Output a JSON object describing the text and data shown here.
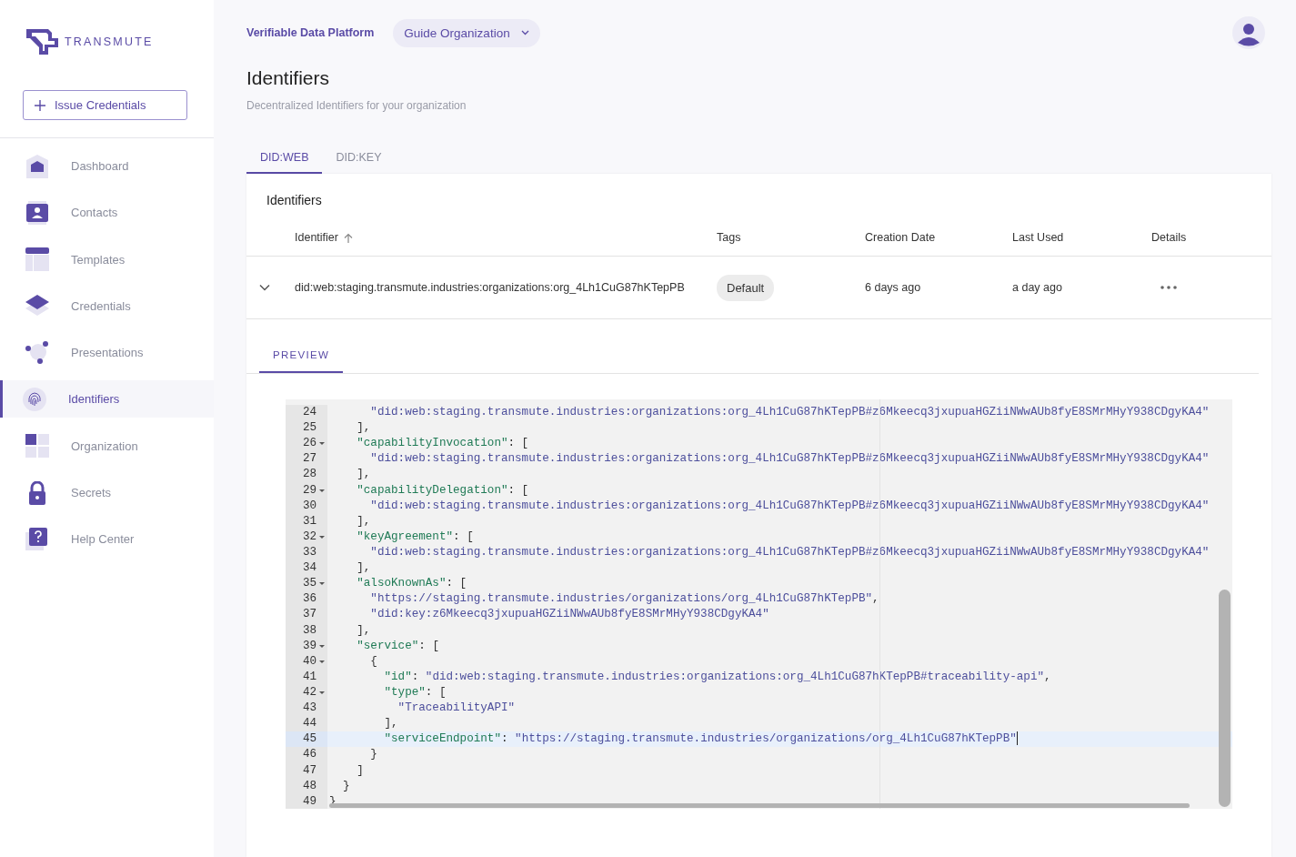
{
  "brand": {
    "name": "TRANSMUTE"
  },
  "sidebar": {
    "action_button": {
      "label": "Issue Credentials"
    },
    "items": [
      {
        "label": "Dashboard",
        "selected": false
      },
      {
        "label": "Contacts",
        "selected": false
      },
      {
        "label": "Templates",
        "selected": false
      },
      {
        "label": "Credentials",
        "selected": false
      },
      {
        "label": "Presentations",
        "selected": false
      },
      {
        "label": "Identifiers",
        "selected": true
      },
      {
        "label": "Organization",
        "selected": false
      },
      {
        "label": "Secrets",
        "selected": false
      },
      {
        "label": "Help Center",
        "selected": false
      }
    ]
  },
  "header": {
    "platform_link": "Verifiable Data Platform",
    "organization_select": {
      "value": "Guide Organization"
    }
  },
  "page": {
    "title": "Identifiers",
    "subtitle": "Decentralized Identifiers for your organization"
  },
  "tabs": [
    {
      "label": "DID:WEB",
      "selected": true
    },
    {
      "label": "DID:KEY",
      "selected": false
    }
  ],
  "table": {
    "title": "Identifiers",
    "columns": [
      {
        "label": "Identifier",
        "sorted": true
      },
      {
        "label": "Tags",
        "sorted": false
      },
      {
        "label": "Creation Date",
        "sorted": false
      },
      {
        "label": "Last Used",
        "sorted": false
      },
      {
        "label": "Details",
        "sorted": false
      }
    ],
    "rows": [
      {
        "expanded": true,
        "identifier": "did:web:staging.transmute.industries:organizations:org_4Lh1CuG87hKTepPB",
        "tags": [
          "Default"
        ],
        "creation_date": "6 days ago",
        "last_used": "a day ago"
      }
    ]
  },
  "detail_tabs": [
    {
      "label": "PREVIEW",
      "selected": true
    }
  ],
  "editor": {
    "lines": [
      {
        "number": "24",
        "foldable": false,
        "active": false,
        "text": "      \"did:web:staging.transmute.industries:organizations:org_4Lh1CuG87hKTepPB#z6Mkeecq3jxupuaHGZiiNWwAUb8fyE8SMrMHyY938CDgyKA4\""
      },
      {
        "number": "25",
        "foldable": false,
        "active": false,
        "text": "    ],"
      },
      {
        "number": "26",
        "foldable": true,
        "active": false,
        "text": "    \"capabilityInvocation\": ["
      },
      {
        "number": "27",
        "foldable": false,
        "active": false,
        "text": "      \"did:web:staging.transmute.industries:organizations:org_4Lh1CuG87hKTepPB#z6Mkeecq3jxupuaHGZiiNWwAUb8fyE8SMrMHyY938CDgyKA4\""
      },
      {
        "number": "28",
        "foldable": false,
        "active": false,
        "text": "    ],"
      },
      {
        "number": "29",
        "foldable": true,
        "active": false,
        "text": "    \"capabilityDelegation\": ["
      },
      {
        "number": "30",
        "foldable": false,
        "active": false,
        "text": "      \"did:web:staging.transmute.industries:organizations:org_4Lh1CuG87hKTepPB#z6Mkeecq3jxupuaHGZiiNWwAUb8fyE8SMrMHyY938CDgyKA4\""
      },
      {
        "number": "31",
        "foldable": false,
        "active": false,
        "text": "    ],"
      },
      {
        "number": "32",
        "foldable": true,
        "active": false,
        "text": "    \"keyAgreement\": ["
      },
      {
        "number": "33",
        "foldable": false,
        "active": false,
        "text": "      \"did:web:staging.transmute.industries:organizations:org_4Lh1CuG87hKTepPB#z6Mkeecq3jxupuaHGZiiNWwAUb8fyE8SMrMHyY938CDgyKA4\""
      },
      {
        "number": "34",
        "foldable": false,
        "active": false,
        "text": "    ],"
      },
      {
        "number": "35",
        "foldable": true,
        "active": false,
        "text": "    \"alsoKnownAs\": ["
      },
      {
        "number": "36",
        "foldable": false,
        "active": false,
        "text": "      \"https://staging.transmute.industries/organizations/org_4Lh1CuG87hKTepPB\","
      },
      {
        "number": "37",
        "foldable": false,
        "active": false,
        "text": "      \"did:key:z6Mkeecq3jxupuaHGZiiNWwAUb8fyE8SMrMHyY938CDgyKA4\""
      },
      {
        "number": "38",
        "foldable": false,
        "active": false,
        "text": "    ],"
      },
      {
        "number": "39",
        "foldable": true,
        "active": false,
        "text": "    \"service\": ["
      },
      {
        "number": "40",
        "foldable": true,
        "active": false,
        "text": "      {"
      },
      {
        "number": "41",
        "foldable": false,
        "active": false,
        "text": "        \"id\": \"did:web:staging.transmute.industries:organizations:org_4Lh1CuG87hKTepPB#traceability-api\","
      },
      {
        "number": "42",
        "foldable": true,
        "active": false,
        "text": "        \"type\": ["
      },
      {
        "number": "43",
        "foldable": false,
        "active": false,
        "text": "          \"TraceabilityAPI\""
      },
      {
        "number": "44",
        "foldable": false,
        "active": false,
        "text": "        ],"
      },
      {
        "number": "45",
        "foldable": false,
        "active": true,
        "text": "        \"serviceEndpoint\": \"https://staging.transmute.industries/organizations/org_4Lh1CuG87hKTepPB\""
      },
      {
        "number": "46",
        "foldable": false,
        "active": false,
        "text": "      }"
      },
      {
        "number": "47",
        "foldable": false,
        "active": false,
        "text": "    ]"
      },
      {
        "number": "48",
        "foldable": false,
        "active": false,
        "text": "  }"
      },
      {
        "number": "49",
        "foldable": false,
        "active": false,
        "text": "}"
      }
    ]
  }
}
